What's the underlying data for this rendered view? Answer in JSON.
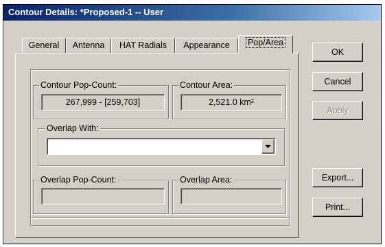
{
  "window": {
    "title": "Contour Details: *Proposed-1 -- User"
  },
  "tabs": [
    {
      "label": "General",
      "active": false
    },
    {
      "label": "Antenna",
      "active": false
    },
    {
      "label": "HAT Radials",
      "active": false
    },
    {
      "label": "Appearance",
      "active": false
    },
    {
      "label": "Pop/Area",
      "active": true
    }
  ],
  "contour": {
    "pop_label": "Contour Pop-Count:",
    "pop_value": "267,999 - [259,703]",
    "area_label": "Contour Area:",
    "area_value": "2,521.0 km²"
  },
  "overlap": {
    "with_label": "Overlap With:",
    "with_value": "",
    "pop_label": "Overlap Pop-Count:",
    "pop_value": "",
    "area_label": "Overlap Area:",
    "area_value": ""
  },
  "buttons": {
    "ok": "OK",
    "cancel": "Cancel",
    "apply": "Apply",
    "export": "Export...",
    "print": "Print..."
  }
}
